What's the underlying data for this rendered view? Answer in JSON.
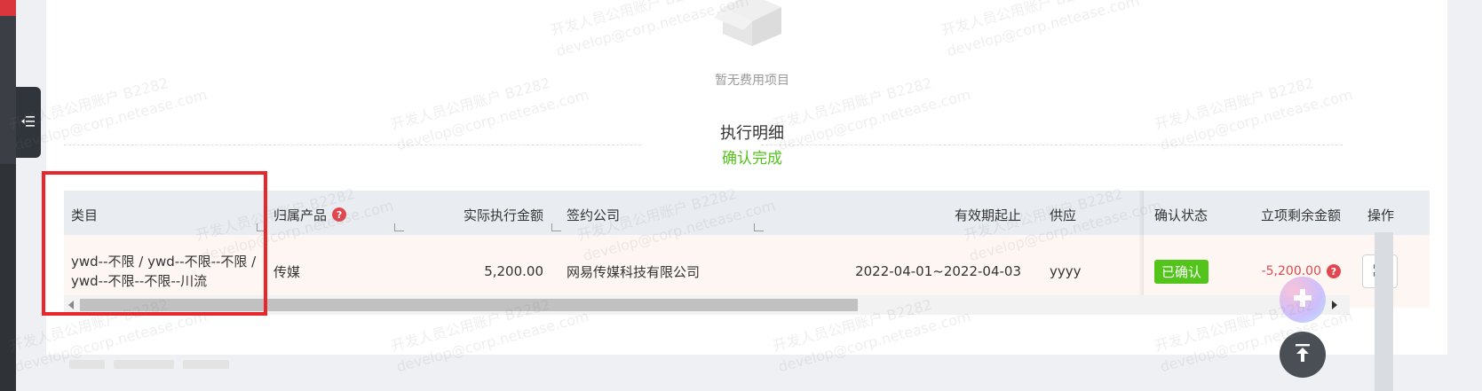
{
  "empty_state": {
    "text": "暂无费用项目"
  },
  "section": {
    "title": "执行明细",
    "status": "确认完成"
  },
  "table": {
    "columns": {
      "category": "类目",
      "product": "归属产品",
      "actual_amount": "实际执行金额",
      "company": "签约公司",
      "valid_period": "有效期起止",
      "supplier": "供应",
      "confirm_status": "确认状态",
      "remaining": "立项剩余金额",
      "action": "操作"
    },
    "rows": [
      {
        "category": "ywd--不限 / ywd--不限--不限 / ywd--不限--不限--川流",
        "product": "传媒",
        "actual_amount": "5,200.00",
        "company": "网易传媒科技有限公司",
        "valid_period": "2022-04-01~2022-04-03",
        "supplier": "yyyy",
        "confirm_status": "已确认",
        "remaining": "-5,200.00"
      }
    ]
  },
  "help_symbol": "?",
  "watermark": {
    "line1": "开发人员公用账户 B2282",
    "line2": "develop@corp.netease.com"
  },
  "colors": {
    "success": "#52c41a",
    "danger": "#e04850",
    "highlight": "#e8272c"
  },
  "icons": [
    "sidebar-collapse-icon",
    "empty-box-icon",
    "help-icon",
    "expand-icon",
    "plus-icon",
    "back-to-top-icon"
  ]
}
